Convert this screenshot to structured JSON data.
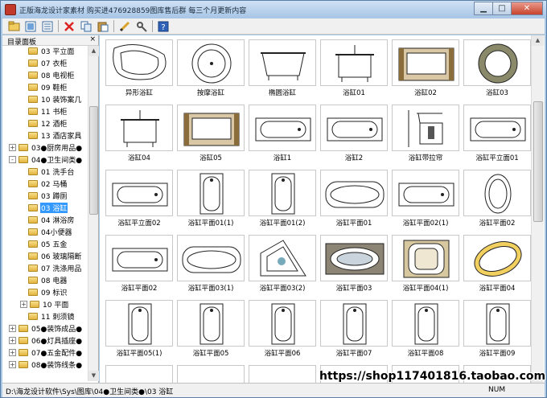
{
  "window": {
    "title": "正版海龙设计家素材 购买进476928859图库售后群 每三个月更新内容",
    "buttons": [
      "minimize",
      "maximize",
      "close"
    ]
  },
  "toolbar": {
    "buttons": [
      "open-icon",
      "view-large-icon",
      "view-list-icon",
      "delete-icon",
      "copy-icon",
      "paste-icon",
      "draw-icon",
      "tools-icon",
      "help-icon"
    ]
  },
  "sidebar": {
    "title": "目录面板",
    "close_label": "×",
    "items": [
      {
        "label": "03 平立面",
        "level": 2,
        "expander": false
      },
      {
        "label": "07 衣柜",
        "level": 2,
        "expander": false
      },
      {
        "label": "08 电视柜",
        "level": 2,
        "expander": false
      },
      {
        "label": "09 鞋柜",
        "level": 2,
        "expander": false
      },
      {
        "label": "10 装饰案几",
        "level": 2,
        "expander": false
      },
      {
        "label": "11 书柜",
        "level": 2,
        "expander": false
      },
      {
        "label": "12 酒柜",
        "level": 2,
        "expander": false
      },
      {
        "label": "13 酒店家具",
        "level": 2,
        "expander": false
      },
      {
        "label": "03●厨房用品●",
        "level": 1,
        "expander": "+"
      },
      {
        "label": "04●卫生间类●",
        "level": 1,
        "expander": "-"
      },
      {
        "label": "01 洗手台",
        "level": 2,
        "expander": false
      },
      {
        "label": "02 马桶",
        "level": 2,
        "expander": false
      },
      {
        "label": "03 蹲厕",
        "level": 2,
        "expander": false
      },
      {
        "label": "03 浴缸",
        "level": 2,
        "expander": false,
        "selected": true
      },
      {
        "label": "04 淋浴房",
        "level": 2,
        "expander": false
      },
      {
        "label": "04小便器",
        "level": 2,
        "expander": false
      },
      {
        "label": "05 五金",
        "level": 2,
        "expander": false
      },
      {
        "label": "06 玻璃隔断",
        "level": 2,
        "expander": false
      },
      {
        "label": "07 洗涤用品",
        "level": 2,
        "expander": false
      },
      {
        "label": "08 电器",
        "level": 2,
        "expander": false
      },
      {
        "label": "09 标识",
        "level": 2,
        "expander": false
      },
      {
        "label": "10 平面",
        "level": 2,
        "expander": "+"
      },
      {
        "label": "11 刺须镜",
        "level": 2,
        "expander": false
      },
      {
        "label": "05●装饰成品●",
        "level": 1,
        "expander": "+"
      },
      {
        "label": "06●灯具插座●",
        "level": 1,
        "expander": "+"
      },
      {
        "label": "07●五金配件●",
        "level": 1,
        "expander": "+"
      },
      {
        "label": "08●装饰线条●",
        "level": 1,
        "expander": "+"
      }
    ]
  },
  "gallery": {
    "items": [
      {
        "label": "异形浴缸",
        "shape": "odd"
      },
      {
        "label": "按摩浴缸",
        "shape": "round"
      },
      {
        "label": "椭圆浴缸",
        "shape": "oval-front"
      },
      {
        "label": "浴缸01",
        "shape": "tub-front"
      },
      {
        "label": "浴缸02",
        "shape": "tub-section"
      },
      {
        "label": "浴缸03",
        "shape": "round-hatch"
      },
      {
        "label": "浴缸04",
        "shape": "tub-front"
      },
      {
        "label": "浴缸05",
        "shape": "tub-section"
      },
      {
        "label": "浴缸1",
        "shape": "plan"
      },
      {
        "label": "浴缸2",
        "shape": "plan"
      },
      {
        "label": "浴缸带拉帘",
        "shape": "curtain"
      },
      {
        "label": "浴缸平立面01",
        "shape": "plan"
      },
      {
        "label": "浴缸平立面02",
        "shape": "plan"
      },
      {
        "label": "浴缸平面01(1)",
        "shape": "plan-vertical"
      },
      {
        "label": "浴缸平面01(2)",
        "shape": "plan-vertical"
      },
      {
        "label": "浴缸平面01",
        "shape": "oval-plan"
      },
      {
        "label": "浴缸平面02(1)",
        "shape": "plan"
      },
      {
        "label": "浴缸平面02",
        "shape": "oval-small"
      },
      {
        "label": "浴缸平面02",
        "shape": "plan"
      },
      {
        "label": "浴缸平面03(1)",
        "shape": "oval-plan"
      },
      {
        "label": "浴缸平面03(2)",
        "shape": "corner"
      },
      {
        "label": "浴缸平面03",
        "shape": "jacuzzi"
      },
      {
        "label": "浴缸平面04(1)",
        "shape": "double"
      },
      {
        "label": "浴缸平面04",
        "shape": "oval-tilt"
      },
      {
        "label": "浴缸平面05(1)",
        "shape": "plan-vertical"
      },
      {
        "label": "浴缸平面05",
        "shape": "plan-vertical"
      },
      {
        "label": "浴缸平面06",
        "shape": "plan-vertical"
      },
      {
        "label": "浴缸平面07",
        "shape": "plan-vertical"
      },
      {
        "label": "浴缸平面08",
        "shape": "plan-vertical"
      },
      {
        "label": "浴缸平面09",
        "shape": "plan-vertical"
      },
      {
        "label": "",
        "shape": "partial"
      },
      {
        "label": "",
        "shape": "partial"
      },
      {
        "label": "",
        "shape": "partial"
      },
      {
        "label": "",
        "shape": "partial"
      },
      {
        "label": "",
        "shape": "partial"
      },
      {
        "label": "",
        "shape": "partial"
      }
    ]
  },
  "status": {
    "path": "D:\\海龙设计软件\\Sys\\图库\\04●卫生间类●\\03 浴缸",
    "num": "NUM"
  },
  "watermark": "https://shop117401816.taobao.com"
}
